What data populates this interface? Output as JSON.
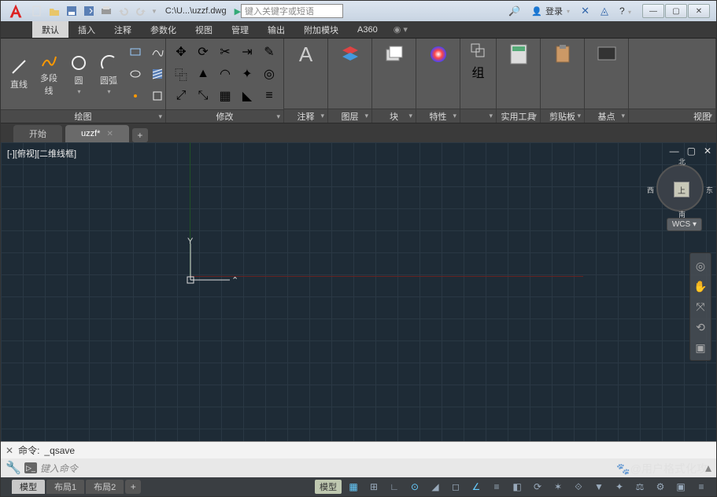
{
  "title_path": "C:\\U...\\uzzf.dwg",
  "search_placeholder": "键入关键字或短语",
  "sign_in": "登录",
  "menu_tabs": [
    "默认",
    "插入",
    "注释",
    "参数化",
    "视图",
    "管理",
    "输出",
    "附加模块",
    "A360"
  ],
  "ribbon": {
    "draw": {
      "title": "绘图",
      "items": [
        "直线",
        "多段线",
        "圆",
        "圆弧"
      ]
    },
    "modify": {
      "title": "修改"
    },
    "annotate": "注释",
    "layer": "图层",
    "block": "块",
    "props": "特性",
    "group": "组",
    "utils": "实用工具",
    "clip": "剪贴板",
    "base": "基点",
    "view": "视图"
  },
  "doc_tabs": {
    "start": "开始",
    "file": "uzzf*"
  },
  "viewport_label": "[-][俯视][二维线框]",
  "nav": {
    "face": "上",
    "n": "北",
    "s": "南",
    "e": "东",
    "w": "西",
    "wcs": "WCS"
  },
  "cmd": {
    "label": "命令:",
    "last": "_qsave",
    "placeholder": "键入命令"
  },
  "layouts": {
    "model": "模型",
    "l1": "布局1",
    "l2": "布局2"
  },
  "status_model": "模型",
  "watermark": "@用户格式化攻"
}
